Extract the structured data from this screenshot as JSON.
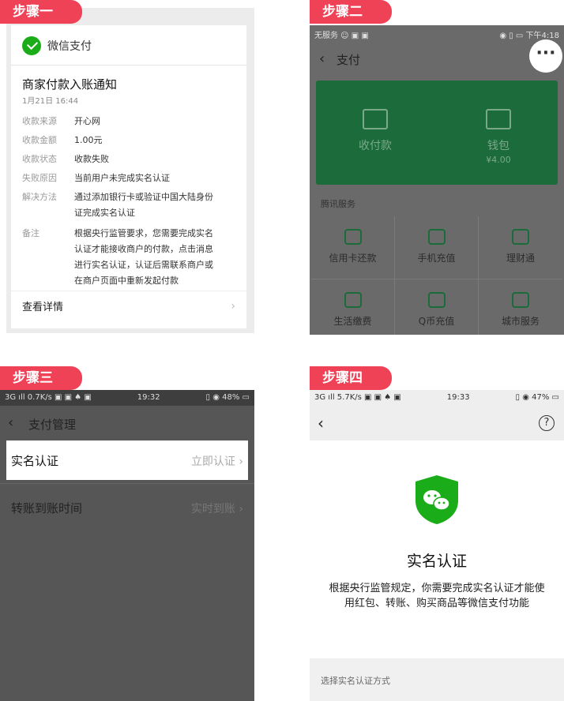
{
  "steps": {
    "s1": "步骤一",
    "s2": "步骤二",
    "s3": "步骤三",
    "s4": "步骤四"
  },
  "panel1": {
    "brand": "微信支付",
    "title": "商家付款入账通知",
    "date": "1月21日  16:44",
    "rows": [
      {
        "k": "收款来源",
        "v": "开心网"
      },
      {
        "k": "收款金额",
        "v": "1.00元"
      },
      {
        "k": "收款状态",
        "v": "收款失败"
      },
      {
        "k": "失败原因",
        "v": "当前用户未完成实名认证"
      },
      {
        "k": "解决方法",
        "v": "通过添加银行卡或验证中国大陆身份证完成实名认证"
      },
      {
        "k": "备注",
        "v": "根据央行监管要求，您需要完成实名认证才能接收商户的付款，点击消息进行实名认证，认证后需联系商户或在商户页面中重新发起付款"
      }
    ],
    "detail": "查看详情",
    "chevron": "›"
  },
  "panel2": {
    "status_left": "无服务 ☺ ▣ ▣",
    "status_right": "◉ ▯ ▭ 下午4:18",
    "back": "‹",
    "title": "支付",
    "more": "···",
    "pay_code": "收付款",
    "wallet": "钱包",
    "wallet_amount": "¥4.00",
    "section": "腾讯服务",
    "services": [
      "信用卡还款",
      "手机充值",
      "理财通",
      "生活缴费",
      "Q币充值",
      "城市服务"
    ]
  },
  "panel3": {
    "status_left": "3G ıll  0.7K/s ▣ ▣ ♠ ▣",
    "status_time": "19:32",
    "status_right": "▯ ◉ 48% ▭",
    "back": "‹",
    "title": "支付管理",
    "row1_label": "实名认证",
    "row1_action": "立即认证 ›",
    "row2_label": "转账到账时间",
    "row2_action": "实时到账 ›"
  },
  "panel4": {
    "status_left": "3G ıll  5.7K/s ▣ ▣ ♠ ▣",
    "status_time": "19:33",
    "status_right": "▯ ◉ 47% ▭",
    "back": "‹",
    "help": "?",
    "heading": "实名认证",
    "desc": "根据央行监管规定，你需要完成实名认证才能使用红包、转账、购买商品等微信支付功能",
    "choose": "选择实名认证方式",
    "shield_color": "#1aad19"
  }
}
